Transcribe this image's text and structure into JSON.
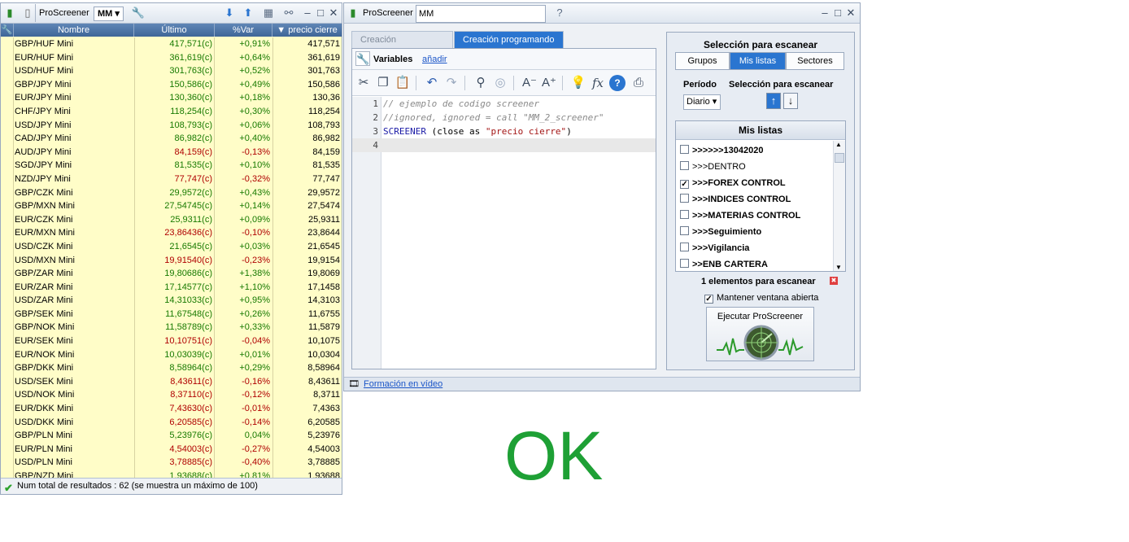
{
  "left_window": {
    "title": "ProScreener",
    "list_select": "MM",
    "columns": [
      "Nombre",
      "Último",
      "%Var",
      "precio cierre"
    ],
    "rows": [
      [
        "GBP/HUF Mini",
        "417,571(c)",
        "+0,91%",
        "417,571"
      ],
      [
        "EUR/HUF Mini",
        "361,619(c)",
        "+0,64%",
        "361,619"
      ],
      [
        "USD/HUF Mini",
        "301,763(c)",
        "+0,52%",
        "301,763"
      ],
      [
        "GBP/JPY Mini",
        "150,586(c)",
        "+0,49%",
        "150,586"
      ],
      [
        "EUR/JPY Mini",
        "130,360(c)",
        "+0,18%",
        "130,36"
      ],
      [
        "CHF/JPY Mini",
        "118,254(c)",
        "+0,30%",
        "118,254"
      ],
      [
        "USD/JPY Mini",
        "108,793(c)",
        "+0,06%",
        "108,793"
      ],
      [
        "CAD/JPY Mini",
        "86,982(c)",
        "+0,40%",
        "86,982"
      ],
      [
        "AUD/JPY Mini",
        "84,159(c)",
        "-0,13%",
        "84,159"
      ],
      [
        "SGD/JPY Mini",
        "81,535(c)",
        "+0,10%",
        "81,535"
      ],
      [
        "NZD/JPY Mini",
        "77,747(c)",
        "-0,32%",
        "77,747"
      ],
      [
        "GBP/CZK Mini",
        "29,9572(c)",
        "+0,43%",
        "29,9572"
      ],
      [
        "GBP/MXN Mini",
        "27,54745(c)",
        "+0,14%",
        "27,5474"
      ],
      [
        "EUR/CZK Mini",
        "25,9311(c)",
        "+0,09%",
        "25,9311"
      ],
      [
        "EUR/MXN Mini",
        "23,86436(c)",
        "-0,10%",
        "23,8644"
      ],
      [
        "USD/CZK Mini",
        "21,6545(c)",
        "+0,03%",
        "21,6545"
      ],
      [
        "USD/MXN Mini",
        "19,91540(c)",
        "-0,23%",
        "19,9154"
      ],
      [
        "GBP/ZAR Mini",
        "19,80686(c)",
        "+1,38%",
        "19,8069"
      ],
      [
        "EUR/ZAR Mini",
        "17,14577(c)",
        "+1,10%",
        "17,1458"
      ],
      [
        "USD/ZAR Mini",
        "14,31033(c)",
        "+0,95%",
        "14,3103"
      ],
      [
        "GBP/SEK Mini",
        "11,67548(c)",
        "+0,26%",
        "11,6755"
      ],
      [
        "GBP/NOK Mini",
        "11,58789(c)",
        "+0,33%",
        "11,5879"
      ],
      [
        "EUR/SEK Mini",
        "10,10751(c)",
        "-0,04%",
        "10,1075"
      ],
      [
        "EUR/NOK Mini",
        "10,03039(c)",
        "+0,01%",
        "10,0304"
      ],
      [
        "GBP/DKK Mini",
        "8,58964(c)",
        "+0,29%",
        "8,58964"
      ],
      [
        "USD/SEK Mini",
        "8,43611(c)",
        "-0,16%",
        "8,43611"
      ],
      [
        "USD/NOK Mini",
        "8,37110(c)",
        "-0,12%",
        "8,3711"
      ],
      [
        "EUR/DKK Mini",
        "7,43630(c)",
        "-0,01%",
        "7,4363"
      ],
      [
        "USD/DKK Mini",
        "6,20585(c)",
        "-0,14%",
        "6,20585"
      ],
      [
        "GBP/PLN Mini",
        "5,23976(c)",
        "0,04%",
        "5,23976"
      ],
      [
        "EUR/PLN Mini",
        "4,54003(c)",
        "-0,27%",
        "4,54003"
      ],
      [
        "USD/PLN Mini",
        "3,78885(c)",
        "-0,40%",
        "3,78885"
      ],
      [
        "GBP/NZD Mini",
        "1,93688(c)",
        "+0,81%",
        "1,93688"
      ]
    ],
    "status": "Num total de resultados : 62 (se muestra un máximo de 100)"
  },
  "right_window": {
    "title": "ProScreener",
    "screener_name": "MM",
    "tabs": [
      "Creación simplificada",
      "Creación programando"
    ],
    "variables_label": "Variables",
    "add_link": "añadir",
    "code": {
      "line_numbers": [
        "1",
        "2",
        "3",
        "4"
      ],
      "line1": "// ejemplo de codigo screener",
      "line2": "//ignored, ignored = call \"MM_2_screener\"",
      "line3_kw": "SCREENER",
      "line3_mid": " (close as ",
      "line3_str": "\"precio cierre\"",
      "line3_end": ")"
    },
    "scan": {
      "title": "Selección para escanear",
      "segments": [
        "Grupos",
        "Mis listas",
        "Sectores"
      ],
      "period_label": "Período",
      "selection_label": "Selección para escanear",
      "period_value": "Diario",
      "lists_title": "Mis listas",
      "lists": [
        {
          "label": ">>>>>>13042020",
          "checked": false
        },
        {
          "label": ">>>DENTRO",
          "checked": false
        },
        {
          "label": ">>>FOREX CONTROL",
          "checked": true
        },
        {
          "label": ">>>INDICES CONTROL",
          "checked": false
        },
        {
          "label": ">>>MATERIAS CONTROL",
          "checked": false
        },
        {
          "label": ">>>Seguimiento",
          "checked": false
        },
        {
          "label": ">>>Vigilancia",
          "checked": false
        },
        {
          "label": ">>ENB CARTERA",
          "checked": false
        }
      ],
      "elements_count": "1 elementos para escanear",
      "keep_open": "Mantener ventana abierta",
      "run_button": "Ejecutar ProScreener"
    },
    "video_link": "Formación en vídeo"
  },
  "overlay_text": "OK",
  "colors": {
    "accent": "#2a75d0",
    "grid_bg": "#fffdc8",
    "positive": "#177a00",
    "negative": "#b00000",
    "ok_green": "#1ea035"
  }
}
